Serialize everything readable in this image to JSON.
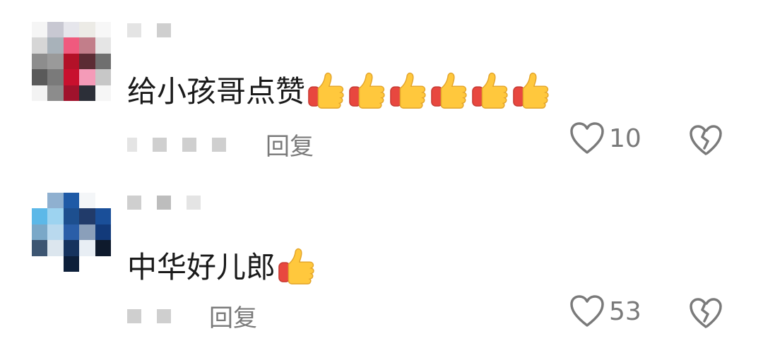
{
  "comments": [
    {
      "text": "给小孩哥点赞",
      "thumbs_count": 6,
      "reply_label": "回复",
      "likes": "10"
    },
    {
      "text": "中华好儿郎",
      "thumbs_count": 1,
      "reply_label": "回复",
      "likes": "53"
    }
  ],
  "icons": {
    "like": "heart-outline-icon",
    "dislike": "broken-heart-icon",
    "thumbs": "thumbs-up-emoji"
  },
  "colors": {
    "text": "#1a1a1a",
    "meta": "#7a7a7a",
    "redacted": "#cfcfcf"
  }
}
